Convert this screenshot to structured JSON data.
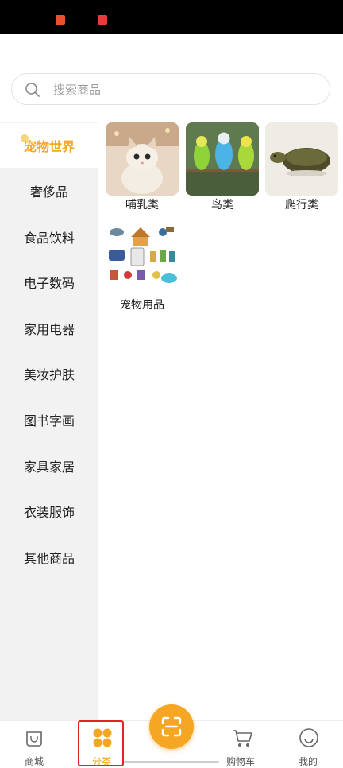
{
  "search": {
    "placeholder": "搜索商品"
  },
  "sidebar": {
    "items": [
      {
        "label": "宠物世界",
        "active": true
      },
      {
        "label": "奢侈品"
      },
      {
        "label": "食品饮料"
      },
      {
        "label": "电子数码"
      },
      {
        "label": "家用电器"
      },
      {
        "label": "美妆护肤"
      },
      {
        "label": "图书字画"
      },
      {
        "label": "家具家居"
      },
      {
        "label": "衣装服饰"
      },
      {
        "label": "其他商品"
      }
    ]
  },
  "categories": [
    {
      "label": "哺乳类",
      "image": "kitten-photo"
    },
    {
      "label": "鸟类",
      "image": "parakeets-photo"
    },
    {
      "label": "爬行类",
      "image": "turtle-photo"
    },
    {
      "label": "宠物用品",
      "image": "pet-supplies-photo"
    }
  ],
  "tabbar": {
    "tabs": [
      {
        "label": "商城",
        "icon": "shop-bag-icon"
      },
      {
        "label": "分类",
        "icon": "category-grid-icon",
        "active": true
      },
      {
        "label": "购物车",
        "icon": "cart-icon"
      },
      {
        "label": "我的",
        "icon": "smile-icon"
      }
    ],
    "center_button_icon": "scan-icon"
  },
  "colors": {
    "accent": "#f5a623",
    "highlight": "#e02424",
    "sidebar_bg": "#f2f2f2"
  }
}
